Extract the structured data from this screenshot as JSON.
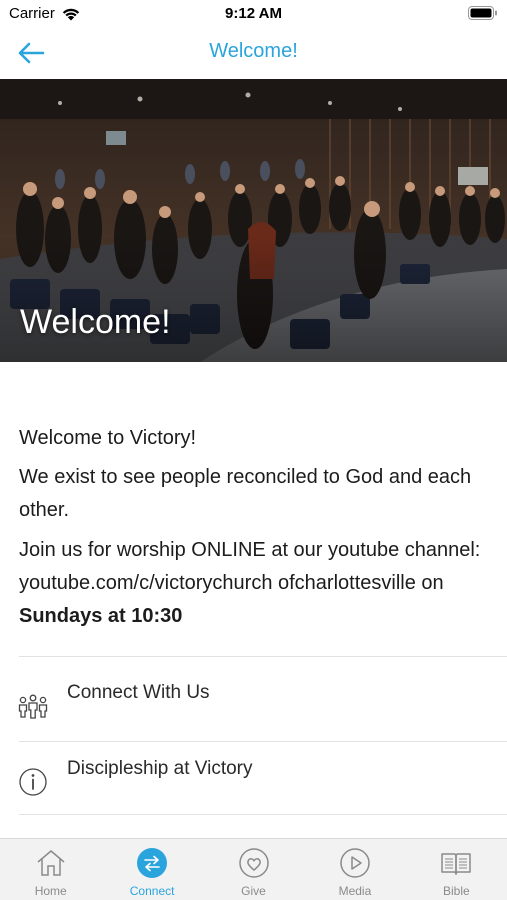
{
  "status_bar": {
    "carrier": "Carrier",
    "time": "9:12 AM"
  },
  "nav": {
    "title": "Welcome!"
  },
  "hero": {
    "title": "Welcome!"
  },
  "content": {
    "p1": "Welcome to Victory!",
    "p2": "We exist to see people reconciled to God and each other.",
    "p3_text": "Join us for worship ONLINE at our youtube channel: youtube.com/c/victorychurch ofcharlottesville on ",
    "p3_bold": "Sundays at 10:30"
  },
  "list": [
    {
      "label": "Connect With Us",
      "icon": "people-group-icon"
    },
    {
      "label": "Discipleship at Victory",
      "icon": "info-icon"
    }
  ],
  "tabs": [
    {
      "label": "Home",
      "icon": "home-icon"
    },
    {
      "label": "Connect",
      "icon": "connect-arrows-icon",
      "active": true
    },
    {
      "label": "Give",
      "icon": "heart-icon"
    },
    {
      "label": "Media",
      "icon": "play-icon"
    },
    {
      "label": "Bible",
      "icon": "book-icon"
    }
  ],
  "colors": {
    "accent": "#2aa4dd",
    "tab_inactive": "#8a8a8a",
    "tab_bar_bg": "#f2f2f2"
  }
}
